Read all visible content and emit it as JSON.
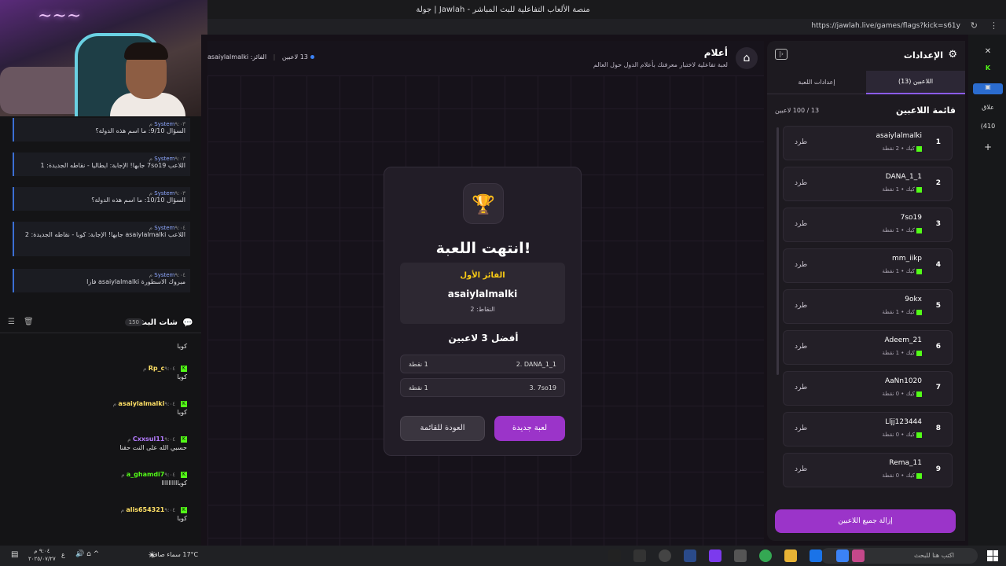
{
  "browser": {
    "title": "جولة | Jawlah - منصة الألعاب التفاعلية للبث المباشر",
    "url": "https://jawlah.live/games/flags?kick=s61y"
  },
  "sidebar_apps": {
    "a": "علاق",
    "b": "(410"
  },
  "chat": {
    "title": "شات البث",
    "count": "150",
    "system": [
      {
        "user": "System",
        "time": "٩:٠٣ م",
        "text": "السؤال 9/10: ما اسم هذه الدولة؟"
      },
      {
        "user": "System",
        "time": "٩:٠٣ م",
        "text": "اللاعب 7so19 جابها! الإجابة: ايطاليا - نقاطه الجديدة: 1"
      },
      {
        "user": "System",
        "time": "٩:٠٣ م",
        "text": "السؤال 10/10: ما اسم هذه الدولة؟"
      },
      {
        "user": "System",
        "time": "٩:٠٤ م",
        "text": "اللاعب asaiylalmalki جابها! الإجابة: كوبا - نقاطه الجديدة: 2"
      },
      {
        "user": "System",
        "time": "٩:٠٤ م",
        "text": "مبروك الاسطورة asaiylalmalki فازا"
      }
    ],
    "messages": [
      {
        "user": "",
        "time": "",
        "text": "كوبا",
        "color": "#ffffff"
      },
      {
        "user": "Rp_c",
        "time": "٩:٠٤ م",
        "text": "كوبا",
        "color": "#ffe066"
      },
      {
        "user": "asaiylalmalki",
        "time": "٩:٠٤ م",
        "text": "كوبا",
        "color": "#ffe066"
      },
      {
        "user": "Cxxsul11",
        "time": "٩:٠٤ م",
        "text": "حسبي الله على النت حقنا",
        "color": "#b57cff"
      },
      {
        "user": "a_ghamdi7",
        "time": "٩:٠٤ م",
        "text": "كوباااااااااا",
        "color": "#53fc18"
      },
      {
        "user": "alis654321",
        "time": "٩:٠٤ م",
        "text": "كوبا",
        "color": "#ffe066"
      }
    ]
  },
  "game": {
    "title": "أعلام",
    "subtitle": "لعبة تفاعلية لاختبار معرفتك بأعلام الدول حول العالم",
    "players_label": "13 لاعبين",
    "winner_label": "الفائز: asaiylalmalki"
  },
  "modal": {
    "title": "انتهت اللعبة!",
    "first_label": "الفائز الأول",
    "winner": "asaiylalmalki",
    "winner_points": "النقاط: 2",
    "top3_title": "أفضل 3 لاعبين",
    "top": [
      {
        "name": "2. DANA_1_1",
        "points": "1 نقطة"
      },
      {
        "name": "3. 7so19",
        "points": "1 نقطة"
      }
    ],
    "back": "العودة للقائمة",
    "new": "لعبة جديدة"
  },
  "panel": {
    "title": "الإعدادات",
    "tab_players": "اللاعبين (13)",
    "tab_settings": "إعدادات اللعبة",
    "list_title": "قائمة اللاعبين",
    "count": "13 / 100 لاعبين",
    "kick": "طرد",
    "remove_all": "إزالة جميع اللاعبين",
    "players": [
      {
        "num": "1",
        "name": "asaiylalmalki",
        "sub": "كيك • 2 نقطة"
      },
      {
        "num": "2",
        "name": "DANA_1_1",
        "sub": "كيك • 1 نقطة"
      },
      {
        "num": "3",
        "name": "7so19",
        "sub": "كيك • 1 نقطة"
      },
      {
        "num": "4",
        "name": "mm_iikp",
        "sub": "كيك • 1 نقطة"
      },
      {
        "num": "5",
        "name": "9okx",
        "sub": "كيك • 1 نقطة"
      },
      {
        "num": "6",
        "name": "Adeem_21",
        "sub": "كيك • 1 نقطة"
      },
      {
        "num": "7",
        "name": "AaNn1020",
        "sub": "كيك • 0 نقطة"
      },
      {
        "num": "8",
        "name": "Lljj123444",
        "sub": "كيك • 0 نقطة"
      },
      {
        "num": "9",
        "name": "Rema_11",
        "sub": "كيك • 0 نقطة"
      }
    ]
  },
  "taskbar": {
    "search": "اكتب هنا للبحث",
    "weather": "17°C سماء صافية",
    "time": "٩:٠٤ م",
    "date": "٢٠٢٥/٠٧/٢٧",
    "lang": "ع"
  },
  "colors": {
    "accent": "#9b34c9",
    "gold": "#facc15",
    "kick_green": "#53fc18"
  }
}
